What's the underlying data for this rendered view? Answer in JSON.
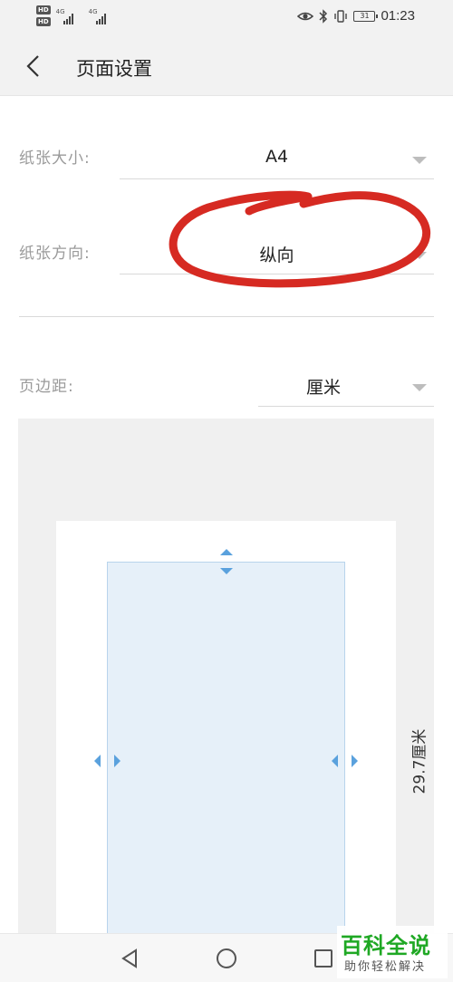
{
  "status_bar": {
    "hd1": "HD",
    "hd2": "HD",
    "network1": "4G",
    "network2": "4G",
    "battery": "31",
    "time": "01:23"
  },
  "header": {
    "title": "页面设置",
    "back_icon": "chevron-left-icon"
  },
  "settings": {
    "paper_size": {
      "label": "纸张大小:",
      "value": "A4"
    },
    "orientation": {
      "label": "纸张方向:",
      "value": "纵向"
    },
    "margin": {
      "label": "页边距:",
      "value": "厘米"
    }
  },
  "preview": {
    "height_label": "29.7厘米"
  },
  "nav_bar": {
    "back_icon": "triangle-back-icon",
    "home_icon": "circle-home-icon",
    "recents_icon": "square-recents-icon"
  },
  "watermark": {
    "title": "百科全说",
    "subtitle": "助你轻松解决"
  },
  "colors": {
    "accent": "#5aa1dd",
    "annotation": "#d62a22",
    "watermark": "#1fa824"
  }
}
